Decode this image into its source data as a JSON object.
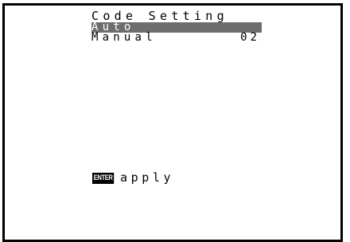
{
  "screen": {
    "title": "Code Setting"
  },
  "menu": {
    "items": [
      {
        "label": "Auto",
        "value": "",
        "selected": true
      },
      {
        "label": "Manual",
        "value": "02",
        "selected": false
      }
    ]
  },
  "footer": {
    "enter_icon_label": "ENTER",
    "action_label": "apply"
  },
  "colors": {
    "highlight": "#6d6d6d",
    "text": "#000000",
    "background": "#ffffff"
  }
}
